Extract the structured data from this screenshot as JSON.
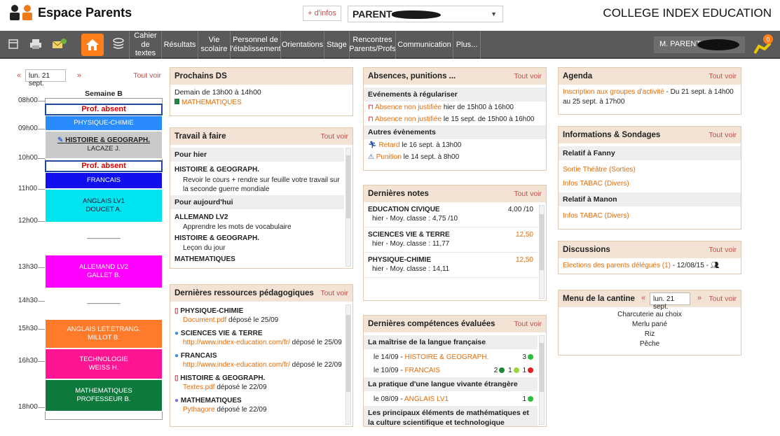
{
  "header": {
    "title": "Espace Parents",
    "dinfos": "+ d'infos",
    "user_label": "PARENT",
    "school": "COLLEGE INDEX EDUCATION"
  },
  "nav": {
    "items": [
      {
        "label": "Cahier de textes"
      },
      {
        "label": "Résultats"
      },
      {
        "label": "Vie scolaire"
      },
      {
        "label": "Personnel de l'établissement"
      },
      {
        "label": "Orientations"
      },
      {
        "label": "Stage"
      },
      {
        "label": "Rencontres Parents/Profs"
      },
      {
        "label": "Communication"
      },
      {
        "label": "Plus..."
      }
    ],
    "user": "M. PARENT",
    "notif_count": "0"
  },
  "timetable": {
    "date": "lun. 21 sept.",
    "tout_voir": "Tout voir",
    "week": "Semaine B",
    "times": [
      "08h00",
      "09h00",
      "10h00",
      "11h00",
      "12h00",
      "13h30",
      "14h30",
      "15h30",
      "16h30",
      "18h00"
    ],
    "blocks": [
      {
        "l1": "Prof. absent",
        "l2": ""
      },
      {
        "l1": "PHYSIQUE-CHIMIE",
        "l2": ""
      },
      {
        "l1": "HISTOIRE & GEOGRAPH.",
        "l2": "LACAZE J."
      },
      {
        "l1": "Prof. absent",
        "l2": ""
      },
      {
        "l1": "FRANCAIS",
        "l2": ""
      },
      {
        "l1": "ANGLAIS LV1",
        "l2": "DOUCET A."
      },
      {
        "l1": "—————",
        "l2": ""
      },
      {
        "l1": "ALLEMAND LV2",
        "l2": "GALLET B."
      },
      {
        "l1": "—————",
        "l2": ""
      },
      {
        "l1": "ANGLAIS LET.ETRANG.",
        "l2": "MILLOT B."
      },
      {
        "l1": "TECHNOLOGIE",
        "l2": "WEISS H."
      },
      {
        "l1": "MATHEMATIQUES",
        "l2": "PROFESSEUR B."
      }
    ]
  },
  "ds": {
    "title": "Prochains DS",
    "when": "Demain de 13h00 à 14h00",
    "subject": "MATHEMATIQUES"
  },
  "travail": {
    "title": "Travail à faire",
    "tout_voir": "Tout voir",
    "hier": "Pour hier",
    "hier_subject": "HISTOIRE & GEOGRAPH.",
    "hier_text": "Revoir le cours + rendre sur feuille votre travail sur la seconde guerre mondiale",
    "auj": "Pour aujourd'hui",
    "items": [
      {
        "subject": "ALLEMAND LV2",
        "text": "Apprendre les mots de vocabulaire"
      },
      {
        "subject": "HISTOIRE & GEOGRAPH.",
        "text": "Leçon du jour"
      },
      {
        "subject": "MATHEMATIQUES",
        "text": ""
      }
    ]
  },
  "ressources": {
    "title": "Dernières ressources pédagogiques",
    "tout_voir": "Tout voir",
    "items": [
      {
        "subject": "PHYSIQUE-CHIMIE",
        "link": "Document.pdf",
        "rest": " déposé le 25/09"
      },
      {
        "subject": "SCIENCES VIE & TERRE",
        "link": "http://www.index-education.com/fr/",
        "rest": " déposé le 25/09"
      },
      {
        "subject": "FRANCAIS",
        "link": "http://www.index-education.com/fr/",
        "rest": " déposé le 22/09"
      },
      {
        "subject": "HISTOIRE & GEOGRAPH.",
        "link": "Textes.pdf",
        "rest": " déposé le 22/09"
      },
      {
        "subject": "MATHEMATIQUES",
        "link": "Pythagore",
        "rest": " déposé le 22/09"
      }
    ]
  },
  "absences": {
    "title": "Absences, punitions ...",
    "tout_voir": "Tout voir",
    "sub1": "Evénements à régulariser",
    "rows1": [
      {
        "link": "Absence non justifiée",
        "rest": " hier de 15h00 à 16h00"
      },
      {
        "link": "Absence non justifiée",
        "rest": " le 15 sept. de 15h00 à 16h00"
      }
    ],
    "sub2": "Autres évènements",
    "rows2": [
      {
        "link": "Retard",
        "rest": " le 16 sept. à 13h00"
      },
      {
        "link": "Punition",
        "rest": " le 14 sept. à 8h00"
      }
    ]
  },
  "notes": {
    "title": "Dernières notes",
    "tout_voir": "Tout voir",
    "items": [
      {
        "subject": "EDUCATION CIVIQUE",
        "grade": "4,00 /10",
        "sub": "hier - Moy. classe : 4,75 /10"
      },
      {
        "subject": "SCIENCES VIE & TERRE",
        "grade": "12,50",
        "sub": "hier - Moy. classe : 11,77"
      },
      {
        "subject": "PHYSIQUE-CHIMIE",
        "grade": "12,50",
        "sub": "hier - Moy. classe : 14,11"
      }
    ]
  },
  "competences": {
    "title": "Dernières compétences évaluées",
    "tout_voir": "Tout voir",
    "sub1": "La maîtrise de la langue française",
    "r1_date": "le 14/09 - ",
    "r1_link": "HISTOIRE & GEOGRAPH.",
    "r1_count": "3",
    "r2_date": "le 10/09 - ",
    "r2_link": "FRANCAIS",
    "r2_c1": "2",
    "r2_c2": "1",
    "r2_c3": "1",
    "sub2": "La pratique d'une langue vivante étrangère",
    "r3_date": "le 08/09 - ",
    "r3_link": "ANGLAIS LV1",
    "r3_count": "1",
    "sub3": "Les principaux éléments de mathématiques et la culture scientifique et technologique"
  },
  "agenda": {
    "title": "Agenda",
    "tout_voir": "Tout voir",
    "link": "Inscription aux groupes d'activité",
    "rest": " - Du 21 sept. à 14h00 au 25 sept. à 17h00"
  },
  "infos": {
    "title": "Informations & Sondages",
    "tout_voir": "Tout voir",
    "sub1": "Relatif à Fanny",
    "links1": [
      "Sortie Théâtre (Sorties)",
      "Infos TABAC (Divers)"
    ],
    "sub2": "Relatif à Manon",
    "links2": [
      "Infos TABAC (Divers)"
    ]
  },
  "discussions": {
    "title": "Discussions",
    "tout_voir": "Tout voir",
    "link": "Elections des parents délégués (1)",
    "rest": " - 12/08/15 -"
  },
  "cantine": {
    "title": "Menu de la cantine",
    "date": "lun. 21 sept.",
    "tout_voir": "Tout voir",
    "items": [
      "Charcuterie au choix",
      "Merlu pané",
      "Riz",
      "Pêche"
    ]
  },
  "colors": {
    "accent": "#ff7e1a",
    "navbar": "#5a5a5a",
    "panel_head": "#f3e3d4",
    "link": "#e46c0a"
  }
}
